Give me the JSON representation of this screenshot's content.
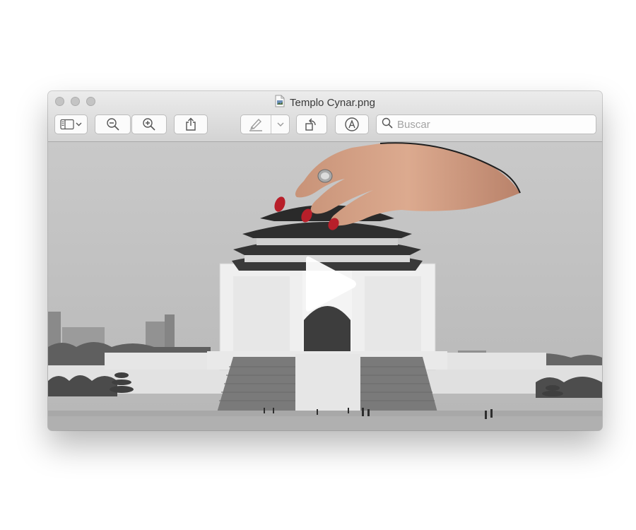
{
  "window": {
    "title": "Templo Cynar.png"
  },
  "toolbar": {
    "sidebar_button": "sidebar-toggle",
    "zoom_out": "zoom-out",
    "zoom_in": "zoom-in",
    "share": "share",
    "markup": "markup-pen",
    "markup_menu": "chevron-down",
    "rotate": "rotate-left",
    "annotate": "annotate"
  },
  "search": {
    "placeholder": "Buscar"
  },
  "colors": {
    "nail_polish": "#b81f2a",
    "skin": "#d9a58a"
  }
}
